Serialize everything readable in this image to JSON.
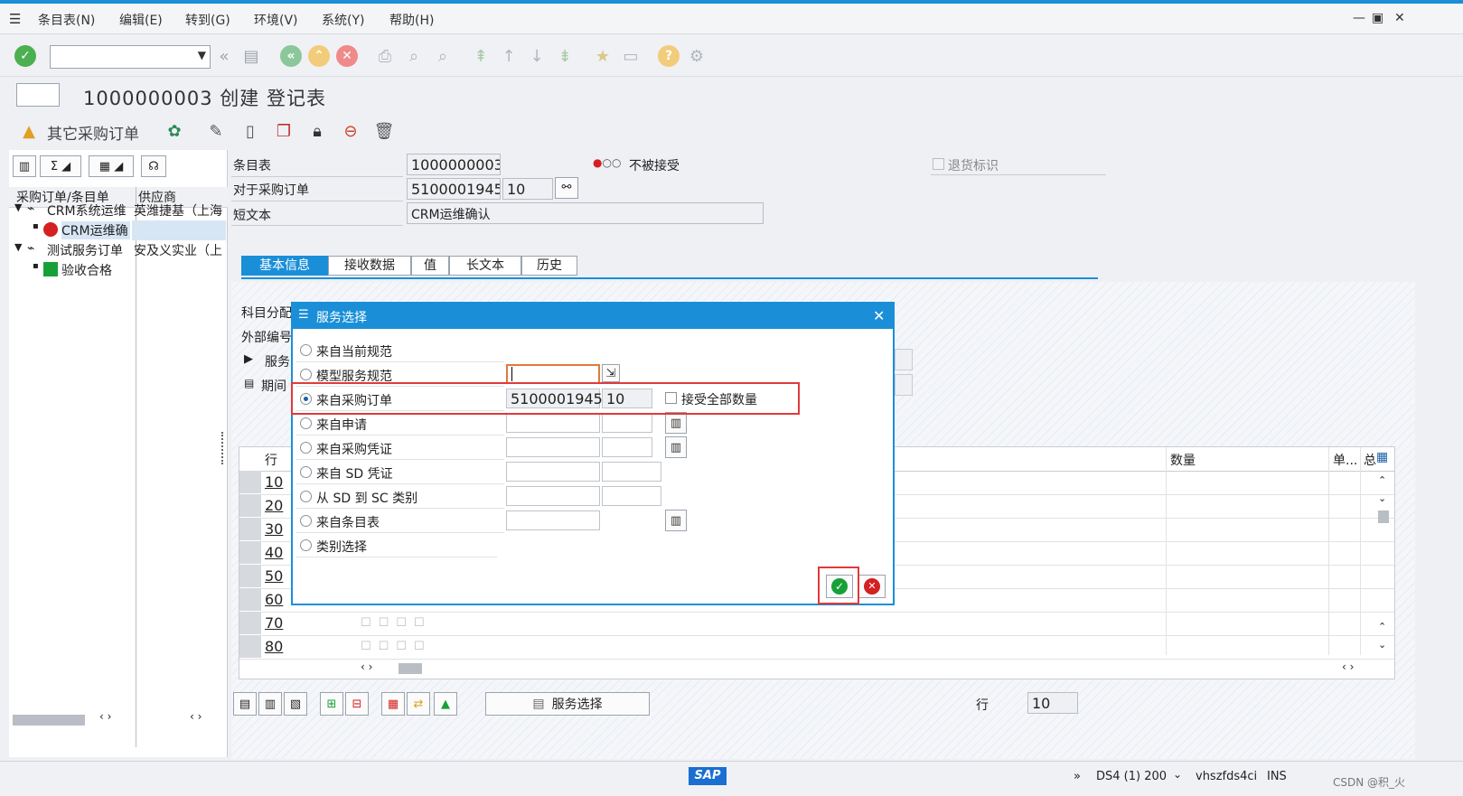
{
  "menu": {
    "items": [
      "条目表(N)",
      "编辑(E)",
      "转到(G)",
      "环境(V)",
      "系统(Y)",
      "帮助(H)"
    ]
  },
  "title": "1000000003 创建 登记表",
  "app_toolbar": {
    "other_po_label": "其它采购订单"
  },
  "tree": {
    "col1_header": "采购订单/条目单",
    "col2_header": "供应商",
    "rows": [
      {
        "label": "CRM系统运维",
        "vendor": "英潍捷基（上海",
        "level": 0
      },
      {
        "label": "CRM运维确",
        "vendor": "",
        "level": 1,
        "status_color": "#d42020"
      },
      {
        "label": "测试服务订单",
        "vendor": "安及义实业（上",
        "level": 0
      },
      {
        "label": "验收合格",
        "vendor": "",
        "level": 1,
        "status_color": "#18a038"
      }
    ]
  },
  "header": {
    "entry_sheet_label": "条目表",
    "entry_sheet_value": "1000000003",
    "po_label": "对于采购订单",
    "po_value": "5100001945",
    "po_item": "10",
    "short_text_label": "短文本",
    "short_text_value": "CRM运维确认",
    "status_text": "不被接受",
    "return_flag_label": "退货标识"
  },
  "tabs": [
    "基本信息",
    "接收数据",
    "值",
    "长文本",
    "历史"
  ],
  "section": {
    "acct_assign_label": "科目分配",
    "ext_num_label": "外部编号",
    "service_label": "服务",
    "period_label": "期间"
  },
  "table": {
    "col_row": "行",
    "col_qty": "数量",
    "col_unit": "单...",
    "col_total": "总",
    "rows": [
      "10",
      "20",
      "30",
      "40",
      "50",
      "60",
      "70",
      "80"
    ]
  },
  "bottom": {
    "service_select_button": "服务选择",
    "row_label": "行",
    "row_value": "10"
  },
  "status": {
    "system": "DS4 (1) 200",
    "server": "vhszfds4ci",
    "mode": "INS",
    "watermark": "CSDN @积_火"
  },
  "dialog": {
    "title": "服务选择",
    "options": [
      {
        "label": "来自当前规范",
        "selected": false
      },
      {
        "label": "模型服务规范",
        "selected": false
      },
      {
        "label": "来自采购订单",
        "selected": true
      },
      {
        "label": "来自申请",
        "selected": false
      },
      {
        "label": "来自采购凭证",
        "selected": false
      },
      {
        "label": "来自 SD 凭证",
        "selected": false
      },
      {
        "label": "从 SD 到 SC 类别",
        "selected": false
      },
      {
        "label": "来自条目表",
        "selected": false
      },
      {
        "label": "类别选择",
        "selected": false
      }
    ],
    "po_value": "5100001945",
    "po_item": "10",
    "accept_all_label": "接受全部数量"
  },
  "colors": {
    "accent": "#1a8fd8",
    "highlight": "#e03a3a"
  }
}
